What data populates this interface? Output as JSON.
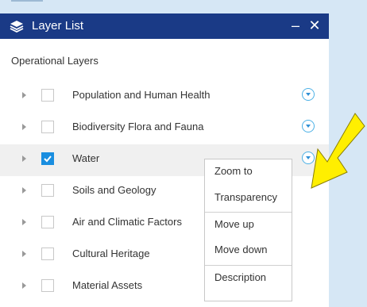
{
  "panel": {
    "title": "Layer List",
    "minimize_glyph": "–",
    "close_glyph": "✕",
    "header_color": "#1a3a86"
  },
  "section_title": "Operational Layers",
  "layers": [
    {
      "label": "Population and Human Health",
      "checked": false
    },
    {
      "label": "Biodiversity Flora and Fauna",
      "checked": false
    },
    {
      "label": "Water",
      "checked": true
    },
    {
      "label": "Soils and Geology",
      "checked": false
    },
    {
      "label": "Air and Climatic Factors",
      "checked": false
    },
    {
      "label": "Cultural Heritage",
      "checked": false
    },
    {
      "label": "Material Assets",
      "checked": false
    }
  ],
  "layer_menu": {
    "items": [
      "Zoom to",
      "Transparency",
      "Move up",
      "Move down",
      "Description"
    ]
  },
  "icons": {
    "header": "layers-icon",
    "expander": "caret-right-icon",
    "menu": "chevron-down-circle-icon",
    "annotation": "yellow-arrow"
  },
  "colors": {
    "accent": "#1a8ee0",
    "highlight_arrow": "#ffef00"
  }
}
